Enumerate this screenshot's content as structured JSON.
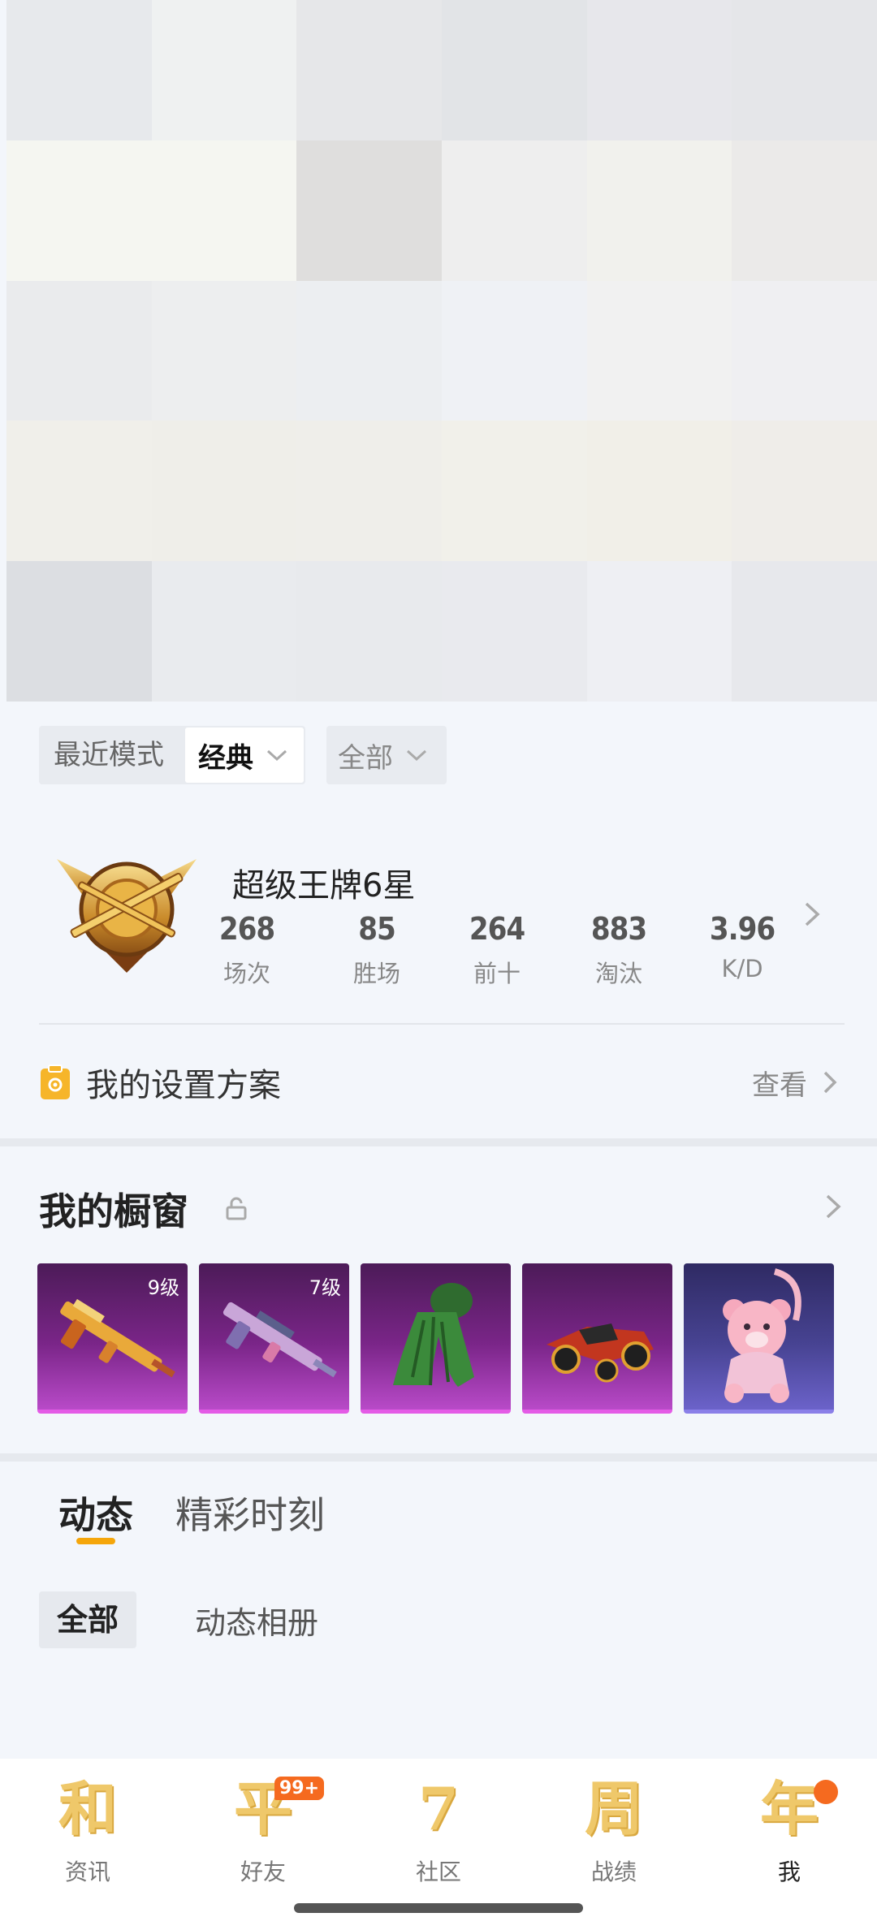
{
  "banner": {
    "tiles": [
      "#e7e9ec",
      "#eff1f1",
      "#e6e7e9",
      "#e2e4e7",
      "#e7e7eb",
      "#e5e6e9",
      "#f5f6f1",
      "#f5f6f1",
      "#dfdedd",
      "#eeeeee",
      "#f1f1ed",
      "#ebeae9",
      "#eaebed",
      "#edeeef",
      "#eceef1",
      "#eff1f5",
      "#f1f1f1",
      "#efeff2",
      "#f0efea",
      "#efeee9",
      "#efeeea",
      "#f1f0ea",
      "#f1efe8",
      "#efede9",
      "#dcdee2",
      "#e9ebee",
      "#e8eaed",
      "#e9eaee",
      "#eeeff3",
      "#e7e8ec"
    ]
  },
  "filters": {
    "mode_label": "最近模式",
    "mode_value": "经典",
    "scope_value": "全部"
  },
  "rank": {
    "title": "超级王牌6星",
    "stats": [
      {
        "value": "268",
        "label": "场次"
      },
      {
        "value": "85",
        "label": "胜场"
      },
      {
        "value": "264",
        "label": "前十"
      },
      {
        "value": "883",
        "label": "淘汰"
      },
      {
        "value": "3.96",
        "label": "K/D"
      }
    ]
  },
  "settings": {
    "title": "我的设置方案",
    "link": "查看"
  },
  "showcase": {
    "title": "我的橱窗",
    "items": [
      {
        "level": "9级",
        "icon": "rifle-gold-icon"
      },
      {
        "level": "7级",
        "icon": "rifle-pink-icon"
      },
      {
        "level": "",
        "icon": "ghillie-suit-icon"
      },
      {
        "level": "",
        "icon": "kart-vehicle-icon"
      },
      {
        "level": "",
        "icon": "bear-backpack-icon"
      }
    ]
  },
  "tabs": {
    "active": "动态",
    "other": "精彩时刻"
  },
  "subtabs": {
    "active": "全部",
    "other": "动态相册"
  },
  "nav": {
    "items": [
      {
        "glyph": "和",
        "label": "资讯"
      },
      {
        "glyph": "平",
        "label": "好友",
        "badge": "99+"
      },
      {
        "glyph": "7",
        "label": "社区"
      },
      {
        "glyph": "周",
        "label": "战绩"
      },
      {
        "glyph": "年",
        "label": "我"
      }
    ]
  }
}
